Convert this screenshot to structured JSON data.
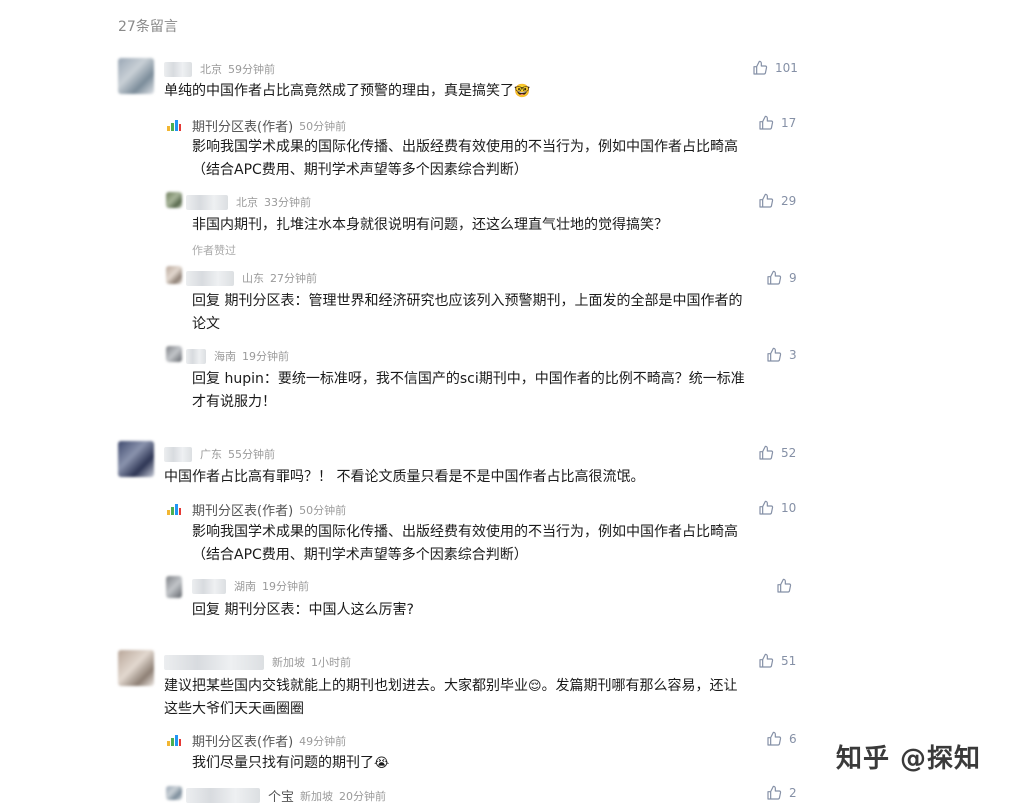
{
  "header": {
    "count_label": "27条留言"
  },
  "c1": {
    "location": "北京",
    "time": "59分钟前",
    "likes": "101",
    "text": "单纯的中国作者占比高竟然成了预警的理由，真是搞笑了",
    "emoji": "🤓"
  },
  "r1a": {
    "author": "期刊分区表(作者)",
    "time": "50分钟前",
    "likes": "17",
    "text_line1": "影响我国学术成果的国际化传播、出版经费有效使用的不当行为，例如中国作者占比畸高",
    "text_line2": "（结合APC费用、期刊学术声望等多个因素综合判断）"
  },
  "r1b": {
    "location": "北京",
    "time": "33分钟前",
    "likes": "29",
    "text": "非国内期刊，扎堆注水本身就很说明有问题，还这么理直气壮地的觉得搞笑？",
    "edited": "作者赞过"
  },
  "r1c": {
    "location": "山东",
    "time": "27分钟前",
    "likes": "9",
    "text_line1": "回复 期刊分区表：管理世界和经济研究也应该列入预警期刊，上面发的全部是中国作者的",
    "text_line2": "论文"
  },
  "r1d": {
    "location": "海南",
    "time": "19分钟前",
    "likes": "3",
    "text_line1": "回复 hupin：要统一标准呀，我不信国产的sci期刊中，中国作者的比例不畸高？统一标准",
    "text_line2": "才有说服力！"
  },
  "c2": {
    "location": "广东",
    "time": "55分钟前",
    "likes": "52",
    "text": "中国作者占比高有罪吗？！ 不看论文质量只看是不是中国作者占比高很流氓。"
  },
  "r2a": {
    "author": "期刊分区表(作者)",
    "time": "50分钟前",
    "likes": "10",
    "text_line1": "影响我国学术成果的国际化传播、出版经费有效使用的不当行为，例如中国作者占比畸高",
    "text_line2": "（结合APC费用、期刊学术声望等多个因素综合判断）"
  },
  "r2b": {
    "location": "湖南",
    "time": "19分钟前",
    "text": "回复 期刊分区表：中国人这么厉害?"
  },
  "c3": {
    "location": "新加坡",
    "time": "1小时前",
    "likes": "51",
    "text_line1a": "建议把某些国内交钱就能上的期刊也划进去。大家都别毕业",
    "emoji": "😌",
    "text_line1b": "。发篇期刊哪有那么容易，还让",
    "text_line2": "这些大爷们天天画圈圈"
  },
  "r3a": {
    "author": "期刊分区表(作者)",
    "time": "49分钟前",
    "likes": "6",
    "text": "我们尽量只找有问题的期刊了",
    "emoji": "😭"
  },
  "r3b": {
    "name_tail": "个宝",
    "location": "新加坡",
    "time": "20分钟前",
    "likes": "2"
  },
  "watermark": "知乎 @探知"
}
